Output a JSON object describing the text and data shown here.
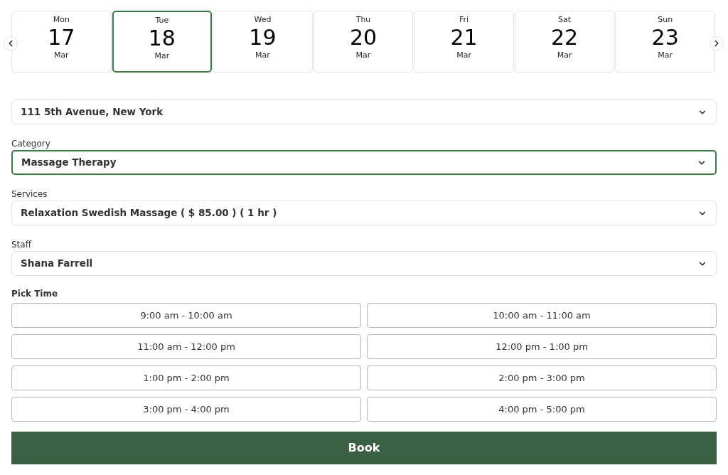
{
  "dates": [
    {
      "weekday": "Mon",
      "day": "17",
      "month": "Mar",
      "selected": false
    },
    {
      "weekday": "Tue",
      "day": "18",
      "month": "Mar",
      "selected": true
    },
    {
      "weekday": "Wed",
      "day": "19",
      "month": "Mar",
      "selected": false
    },
    {
      "weekday": "Thu",
      "day": "20",
      "month": "Mar",
      "selected": false
    },
    {
      "weekday": "Fri",
      "day": "21",
      "month": "Mar",
      "selected": false
    },
    {
      "weekday": "Sat",
      "day": "22",
      "month": "Mar",
      "selected": false
    },
    {
      "weekday": "Sun",
      "day": "23",
      "month": "Mar",
      "selected": false
    }
  ],
  "fields": [
    {
      "value": "111 5th Avenue, New York",
      "focused": false
    },
    {
      "label": "Category",
      "value": "Massage Therapy",
      "focused": true
    },
    {
      "label": "Services",
      "value": "Relaxation Swedish Massage ( $ 85.00 ) ( 1 hr )",
      "focused": false
    },
    {
      "label": "Staff",
      "value": "Shana Farrell",
      "focused": false
    }
  ],
  "time_label": "Pick Time",
  "time_slots": [
    "9:00 am - 10:00 am",
    "10:00 am - 11:00 am",
    "11:00 am - 12:00 pm",
    "12:00 pm - 1:00 pm",
    "1:00 pm - 2:00 pm",
    "2:00 pm - 3:00 pm",
    "3:00 pm - 4:00 pm",
    "4:00 pm - 5:00 pm"
  ],
  "book_button": "Book"
}
